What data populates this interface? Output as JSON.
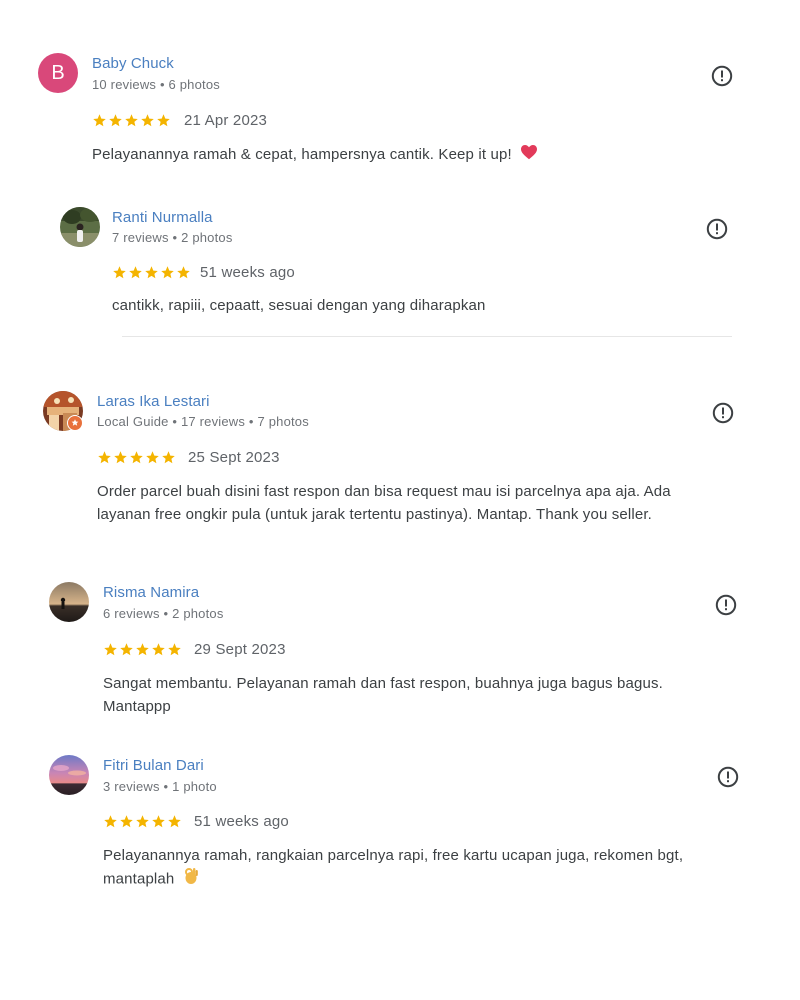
{
  "reviews": [
    {
      "name": "Baby Chuck",
      "avatar_letter": "B",
      "avatar_color": "#d9487a",
      "meta": "10 reviews • 6 photos",
      "rating": 5,
      "date": "21 Apr 2023",
      "text": "Pelayanannya ramah & cepat, hampersnya cantik. Keep it up!",
      "emoji": "heart"
    },
    {
      "name": "Ranti Nurmalla",
      "meta": "7 reviews • 2 photos",
      "rating": 5,
      "date": "51 weeks ago",
      "text": "cantikk, rapiii, cepaatt, sesuai dengan yang diharapkan"
    },
    {
      "name": "Laras Ika Lestari",
      "meta": "Local Guide • 17 reviews • 7 photos",
      "rating": 5,
      "date": "25 Sept 2023",
      "text": "Order parcel buah disini fast respon dan bisa request mau isi parcelnya apa aja. Ada layanan free ongkir pula (untuk jarak tertentu pastinya). Mantap. Thank you seller."
    },
    {
      "name": "Risma Namira",
      "meta": "6 reviews • 2 photos",
      "rating": 5,
      "date": "29 Sept 2023",
      "text": "Sangat membantu. Pelayanan ramah dan fast respon, buahnya juga bagus bagus. Mantappp"
    },
    {
      "name": "Fitri Bulan Dari",
      "meta": "3 reviews • 1 photo",
      "rating": 5,
      "date": "51 weeks ago",
      "text": "Pelayanannya ramah, rangkaian parcelnya rapi, free kartu ucapan juga, rekomen bgt, mantaplah",
      "emoji": "ok-hand"
    }
  ],
  "icons": {
    "report": "report-flag-icon",
    "star": "star-icon",
    "local_guide": "local-guide-badge-icon"
  },
  "colors": {
    "name_link": "#4a7fc0",
    "star": "#f4b400",
    "meta": "#6f7378",
    "body_text": "#3c4043"
  }
}
